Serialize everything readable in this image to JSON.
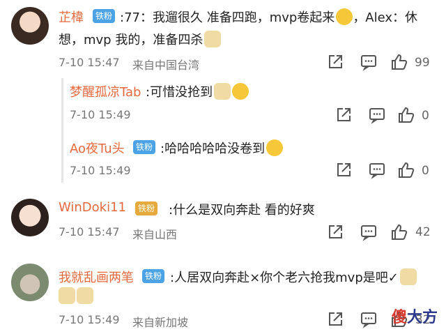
{
  "comments": [
    {
      "username": "芷椲",
      "badge": "铁粉",
      "text1": ":77：我遛很久 准备四跑，mvp卷起来",
      "text1b": "，Alex：休",
      "text2": "想，mvp 我的，准备四杀",
      "time": "7-10 15:47",
      "location": "来自中国台湾",
      "likes": "99",
      "replies": [
        {
          "username": "梦醒孤凉Tab",
          "text": ":可惜没抢到",
          "time": "7-10 15:49",
          "likes": "0"
        },
        {
          "username": "Ao夜Tu头",
          "badge": "铁粉",
          "text": ":哈哈哈哈哈没卷到",
          "time": "7-10 15:49",
          "likes": "0"
        }
      ]
    },
    {
      "username": "WinDoki11",
      "badge": "铁粉",
      "text": ":什么是双向奔赴 看的好爽",
      "time": "7-10 15:47",
      "location": "来自山西",
      "likes": "42"
    },
    {
      "username": "我就乱画两笔",
      "badge": "铁粉",
      "text": ":人居双向奔赴×你个老六抢我mvp是吧✓",
      "time": "7-10 15:49",
      "location": "来自新加坡",
      "likes": "32"
    }
  ],
  "watermark": {
    "red": "傻",
    "rest": "大方"
  },
  "colors": {
    "username": "#e5693f",
    "badge": "#4ba3e6",
    "badge_gold": "#e6a93b",
    "meta": "#777777"
  }
}
